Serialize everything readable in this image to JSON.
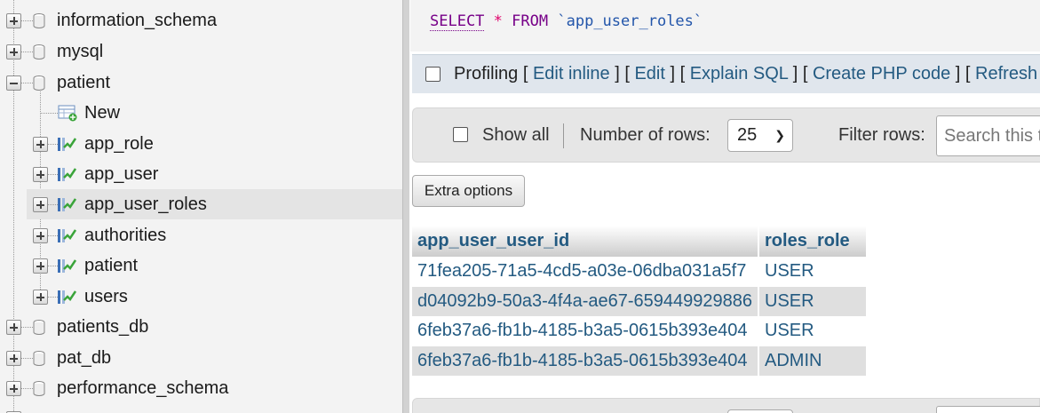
{
  "sidebar": {
    "databases_top": [
      {
        "label": "information_schema",
        "expander": "plus"
      },
      {
        "label": "mysql",
        "expander": "plus"
      },
      {
        "label": "patient",
        "expander": "minus"
      }
    ],
    "patient_children": [
      {
        "label": "New",
        "kind": "new"
      },
      {
        "label": "app_role",
        "kind": "table"
      },
      {
        "label": "app_user",
        "kind": "table"
      },
      {
        "label": "app_user_roles",
        "kind": "table",
        "selected": true
      },
      {
        "label": "authorities",
        "kind": "table"
      },
      {
        "label": "patient",
        "kind": "table"
      },
      {
        "label": "users",
        "kind": "table"
      }
    ],
    "databases_bottom": [
      {
        "label": "patients_db",
        "expander": "plus"
      },
      {
        "label": "pat_db",
        "expander": "plus"
      },
      {
        "label": "performance_schema",
        "expander": "plus"
      }
    ]
  },
  "query": {
    "select_kw": "SELECT",
    "star": "*",
    "from_kw": "FROM",
    "table": "`app_user_roles`"
  },
  "profiling": {
    "label": "Profiling",
    "links": [
      "Edit inline",
      "Edit",
      "Explain SQL",
      "Create PHP code",
      "Refresh"
    ]
  },
  "nav": {
    "show_all": "Show all",
    "rows_label": "Number of rows:",
    "rows_value": "25",
    "filter_label": "Filter rows:",
    "search_placeholder": "Search this ta"
  },
  "extra_options": "Extra options",
  "results": {
    "columns": [
      "app_user_user_id",
      "roles_role"
    ],
    "rows": [
      [
        "71fea205-71a5-4cd5-a03e-06dba031a5f7",
        "USER"
      ],
      [
        "d04092b9-50a3-4f4a-ae67-659449929886",
        "USER"
      ],
      [
        "6feb37a6-fb1b-4185-b3a5-0615b393e404",
        "USER"
      ],
      [
        "6feb37a6-fb1b-4185-b3a5-0615b393e404",
        "ADMIN"
      ]
    ]
  },
  "colors": {
    "link": "#235a81",
    "keyword": "#770088",
    "table_icon_green": "#3aa43a",
    "table_icon_blue": "#3b6fb6"
  }
}
